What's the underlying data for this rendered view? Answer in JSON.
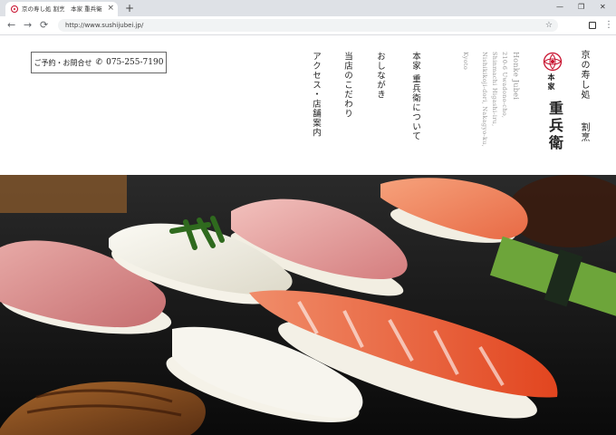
{
  "browser": {
    "tab_title": "京の寿し処 割烹　本家 重兵衛",
    "tab_close": "×",
    "new_tab": "+",
    "url": "http://www.sushijubei.jp/",
    "nav_back": "←",
    "nav_forward": "→",
    "nav_reload": "⟳",
    "star": "☆",
    "menu": "⋮",
    "window": {
      "minimize": "—",
      "maximize": "❐",
      "close": "✕"
    }
  },
  "header": {
    "reserve_label": "ご予約・お問合せ",
    "phone_icon": "✆",
    "reserve_tel": "075-255-7190",
    "menu": [
      "本家 重兵衛について",
      "おしながき",
      "当店のこだわり",
      "アクセス・店舗案内"
    ],
    "address_lines": [
      "Honke Jubei",
      "210-6 Uwadono-cho,",
      "Shinmachi Higashi-iru,",
      "Nishikikoji-dori, Nakagyo-ku,",
      "Kyoto"
    ],
    "logo_sub": "本家",
    "logo_main": "重兵衛",
    "tagline_1": "京の寿し処",
    "tagline_2": "割烹",
    "brand_color": "#c8102e"
  },
  "hero": {
    "image": "sushi-platter-photo"
  }
}
